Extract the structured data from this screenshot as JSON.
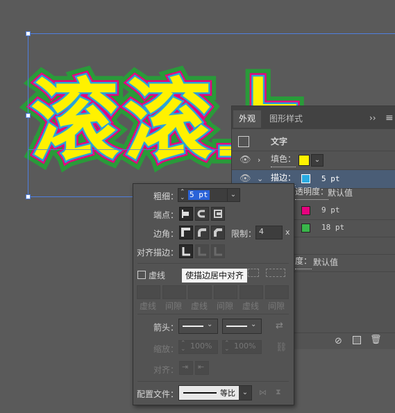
{
  "artwork": {
    "text": "滚滚上"
  },
  "appearance_panel": {
    "tabs": [
      "外观",
      "图形样式"
    ],
    "menu_glyph": "≡",
    "expand_glyph": "››",
    "header": {
      "label": "文字",
      "swatch_color": "#fff200"
    },
    "fill": {
      "label": "填色：",
      "color": "#fff200"
    },
    "stroke": {
      "label": "描边：",
      "value": "5 pt",
      "color": "#29abe2"
    },
    "opacity": {
      "label": "透明度：",
      "value": "默认值"
    },
    "stroke2": {
      "value": "9 pt",
      "color": "#e6007e"
    },
    "stroke3": {
      "value": "18 pt",
      "color": "#39b54a"
    },
    "opacity2": {
      "label": "度：",
      "value": "默认值"
    }
  },
  "stroke_panel": {
    "weight_label": "粗细：",
    "weight_value": "5 pt",
    "cap_label": "端点：",
    "corner_label": "边角：",
    "limit_label": "限制：",
    "limit_value": "4",
    "limit_unit": "x",
    "align_label": "对齐描边：",
    "dashed_label": "虚线",
    "dash_labels": [
      "虚线",
      "间隙",
      "虚线",
      "间隙",
      "虚线",
      "间隙"
    ],
    "arrow_label": "箭头：",
    "scale_label": "缩放：",
    "scale_values": [
      "100%",
      "100%"
    ],
    "align_arrow_label": "对齐：",
    "profile_label": "配置文件：",
    "profile_value": "等比"
  },
  "tooltip": "使描边居中对齐"
}
